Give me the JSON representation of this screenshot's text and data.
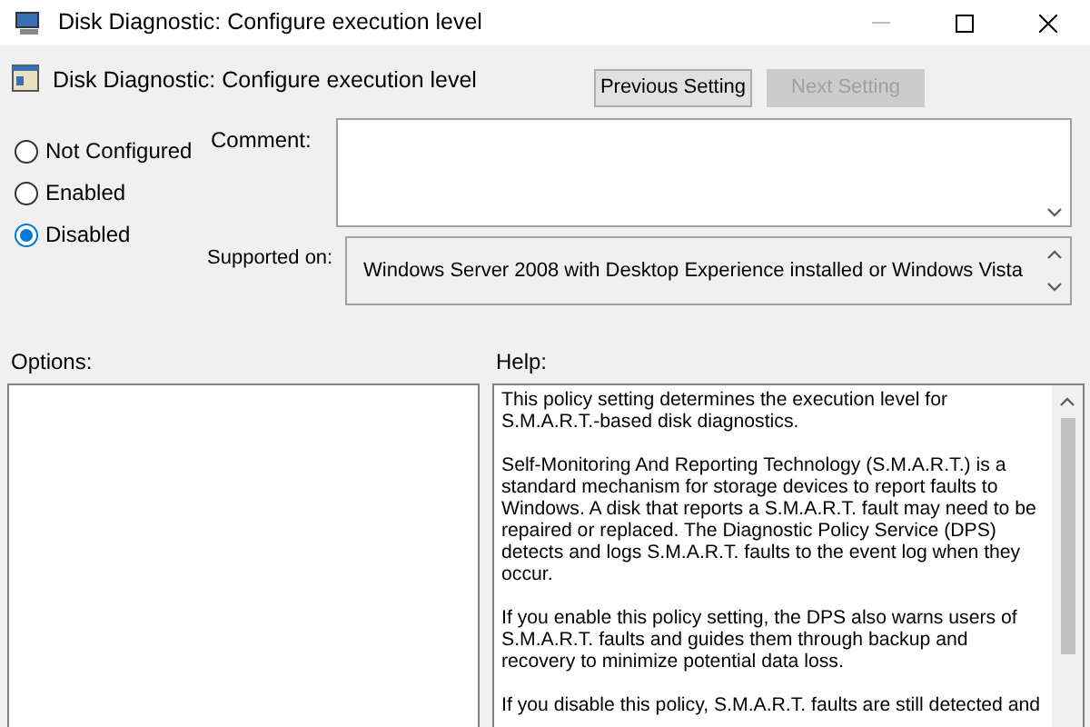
{
  "window": {
    "title": "Disk Diagnostic: Configure execution level"
  },
  "header": {
    "title": "Disk Diagnostic: Configure execution level"
  },
  "nav_buttons": [
    {
      "label": "Previous Setting",
      "disabled": false
    },
    {
      "label": "Next Setting",
      "disabled": true
    }
  ],
  "radios": [
    {
      "label": "Not Configured",
      "selected": false
    },
    {
      "label": "Enabled",
      "selected": false
    },
    {
      "label": "Disabled",
      "selected": true
    }
  ],
  "comment": {
    "label": "Comment:"
  },
  "supported_on": {
    "label": "Supported on:",
    "value": "Windows Server 2008 with Desktop Experience installed or Windows Vista"
  },
  "options": {
    "label": "Options:"
  },
  "help": {
    "label": "Help:",
    "paragraphs": [
      "This policy setting determines the execution level for S.M.A.R.T.-based disk diagnostics.",
      "Self-Monitoring And Reporting Technology (S.M.A.R.T.) is a standard mechanism for storage devices to report faults to Windows. A disk that reports a S.M.A.R.T. fault may need to be repaired or replaced. The Diagnostic Policy Service (DPS) detects and logs S.M.A.R.T. faults to the event log when they occur.",
      "If you enable this policy setting, the DPS also warns users of S.M.A.R.T. faults and guides them through backup and recovery to minimize potential data loss.",
      "If you disable this policy, S.M.A.R.T. faults are still detected and"
    ]
  }
}
